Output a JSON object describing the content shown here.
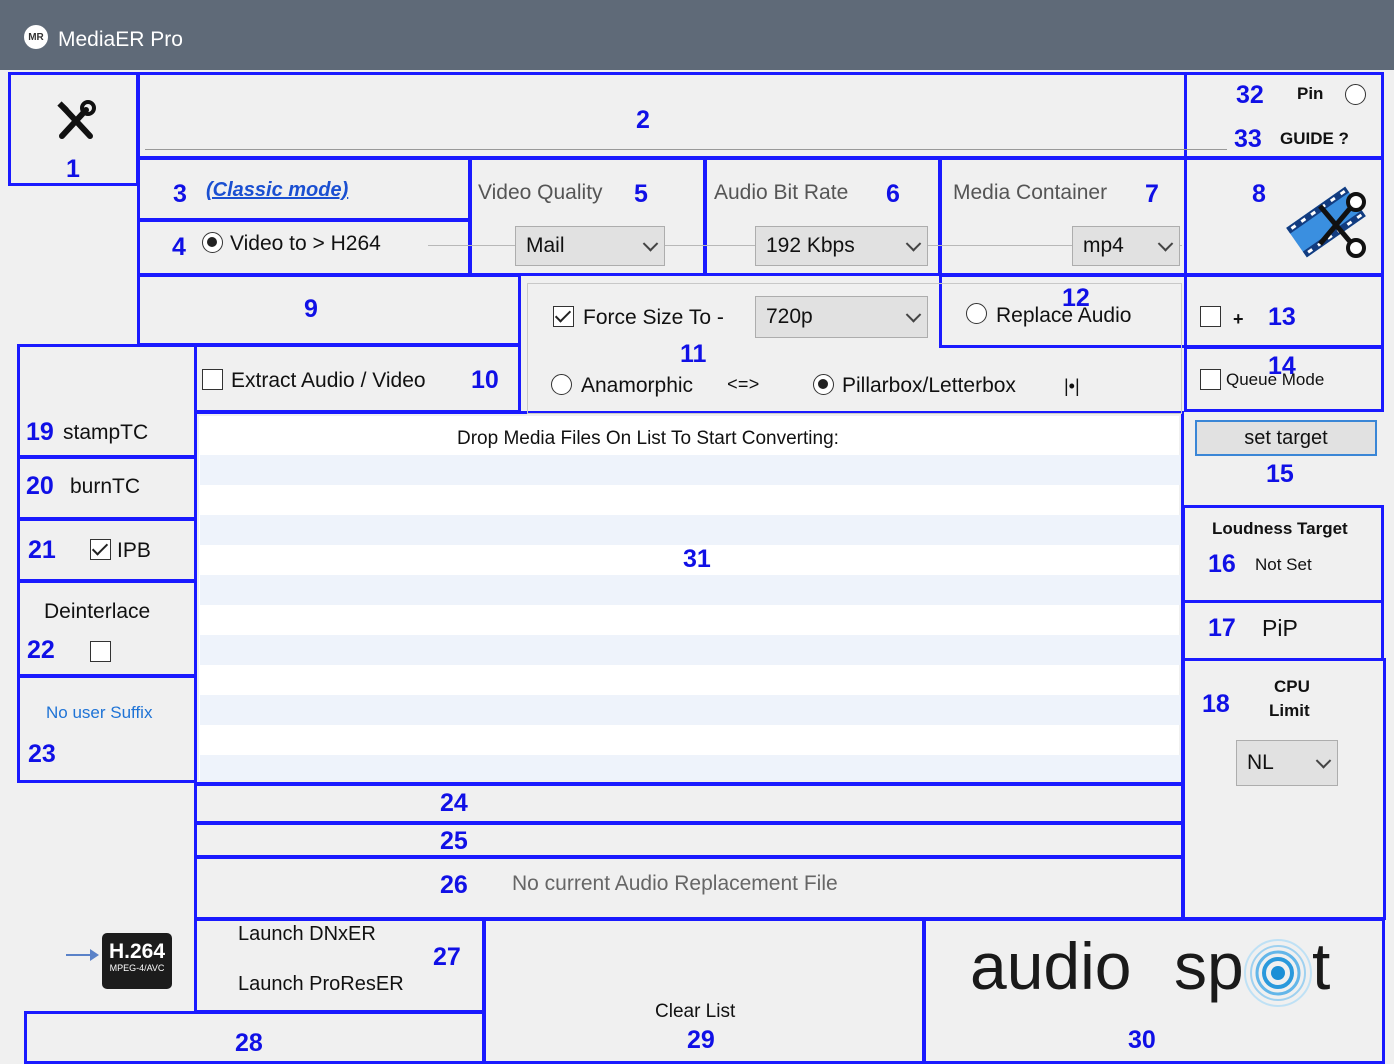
{
  "window": {
    "title": "MediaER Pro",
    "logo": "MR"
  },
  "markers": {
    "m1": "1",
    "m2": "2",
    "m3": "3",
    "m4": "4",
    "m5": "5",
    "m6": "6",
    "m7": "7",
    "m8": "8",
    "m9": "9",
    "m10": "10",
    "m11": "11",
    "m12": "12",
    "m13": "13",
    "m14": "14",
    "m15": "15",
    "m16": "16",
    "m17": "17",
    "m18": "18",
    "m19": "19",
    "m20": "20",
    "m21": "21",
    "m22": "22",
    "m23": "23",
    "m24": "24",
    "m25": "25",
    "m26": "26",
    "m27": "27",
    "m28": "28",
    "m29": "29",
    "m30": "30",
    "m31": "31",
    "m32": "32",
    "m33": "33"
  },
  "header": {
    "pin_label": "Pin",
    "guide_label": "GUIDE ?"
  },
  "mode": {
    "link_label": "(Classic mode)",
    "video_option": "Video to > H264"
  },
  "video_quality": {
    "label": "Video Quality",
    "selected": "Mail"
  },
  "audio_bitrate": {
    "label": "Audio Bit Rate",
    "selected": "192 Kbps"
  },
  "container": {
    "label": "Media Container",
    "selected": "mp4"
  },
  "force_size": {
    "label": "Force Size To -",
    "checked": true,
    "selected": "720p"
  },
  "aspect": {
    "anamorphic": "Anamorphic",
    "anamorphic_glyph": "<=>",
    "pillarbox": "Pillarbox/Letterbox",
    "pillarbox_glyph": "|•|"
  },
  "replace_audio": {
    "label": "Replace Audio"
  },
  "plus_option": {
    "label": "+"
  },
  "queue_mode": {
    "label": "Queue Mode"
  },
  "set_target": {
    "label": "set target"
  },
  "loudness": {
    "title": "Loudness Target",
    "value": "Not Set"
  },
  "pip": {
    "label": "PiP"
  },
  "cpu": {
    "line1": "CPU",
    "line2": "Limit",
    "selected": "NL"
  },
  "left_panel": {
    "stamp_tc": "stampTC",
    "burn_tc": "burnTC",
    "ipb": "IPB",
    "deinterlace": "Deinterlace",
    "suffix": "No user Suffix"
  },
  "extract": {
    "label": "Extract Audio / Video"
  },
  "list": {
    "header": "Drop Media Files On List To Start Converting:"
  },
  "audio_replacement": {
    "status": "No current Audio Replacement File"
  },
  "launch": {
    "dnxer": "Launch DNxER",
    "proreser": "Launch ProResER"
  },
  "clear": {
    "label": "Clear List"
  },
  "badge": {
    "line1": "H.264",
    "line2": "MPEG-4/AVC"
  },
  "brand": {
    "part1": "audio",
    "part2": "sp",
    "part3": "t"
  },
  "colors": {
    "annotation": "#1a1aff",
    "titlebar": "#5f6a78",
    "link": "#1a4fd1",
    "suffix": "#1e73d6"
  }
}
